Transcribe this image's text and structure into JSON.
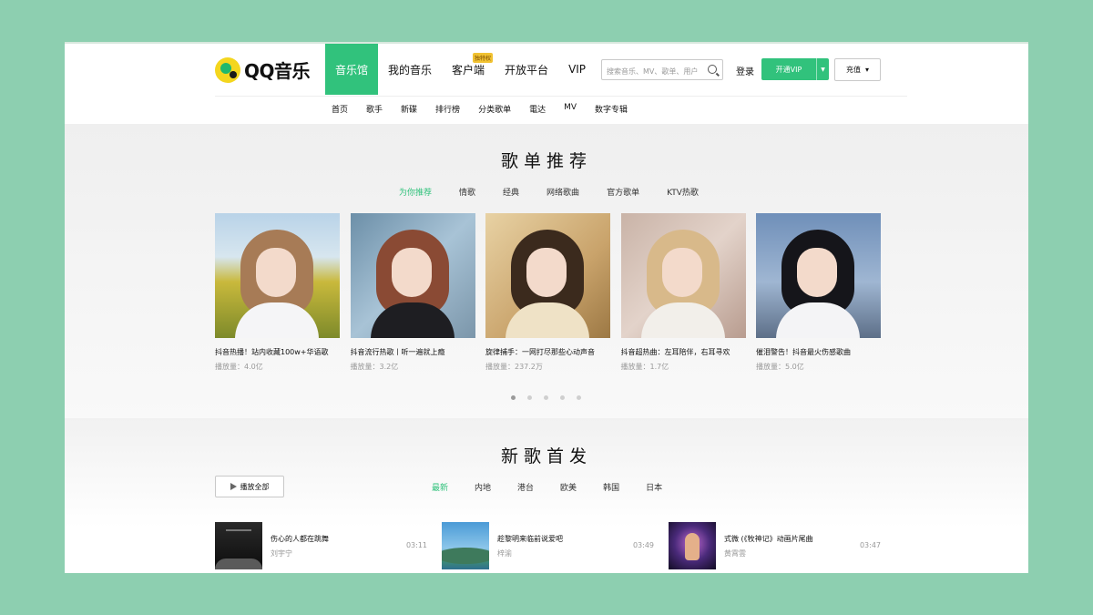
{
  "header": {
    "logo_text": "QQ音乐",
    "nav": [
      {
        "label": "音乐馆",
        "active": true
      },
      {
        "label": "我的音乐",
        "active": false
      },
      {
        "label": "客户端",
        "active": false,
        "badge": "独特权"
      },
      {
        "label": "开放平台",
        "active": false
      },
      {
        "label": "VIP",
        "active": false
      }
    ],
    "search_placeholder": "搜索音乐、MV、歌单、用户",
    "login_label": "登录",
    "vip_button_label": "开通VIP",
    "recharge_label": "充值",
    "subnav": [
      "首页",
      "歌手",
      "新碟",
      "排行榜",
      "分类歌单",
      "電达",
      "MV",
      "数字专辑"
    ]
  },
  "playlists_section": {
    "title": "歌单推荐",
    "tabs": [
      "为你推荐",
      "情歌",
      "经典",
      "网络歌曲",
      "官方歌单",
      "KTV热歌"
    ],
    "active_tab": 0,
    "cards": [
      {
        "title": "抖音热播！站内收藏100w+华语歌",
        "plays": "播放量：4.0亿"
      },
      {
        "title": "抖音流行热歌丨听一遍就上瘾",
        "plays": "播放量：3.2亿"
      },
      {
        "title": "旋律捕手：一网打尽那些心动声音",
        "plays": "播放量：237.2万"
      },
      {
        "title": "抖音超热曲：左耳陪伴，右耳寻欢",
        "plays": "播放量：1.7亿"
      },
      {
        "title": "催泪警告！抖音最火伤感歌曲",
        "plays": "播放量：5.0亿"
      }
    ],
    "dots_count": 5,
    "active_dot": 0
  },
  "new_songs_section": {
    "title": "新歌首发",
    "play_all_label": "播放全部",
    "tabs": [
      "最新",
      "内地",
      "港台",
      "欧美",
      "韩国",
      "日本"
    ],
    "active_tab": 0,
    "songs": [
      {
        "name": "伤心的人都在跳舞",
        "artist": "刘宇宁",
        "duration": "03:11"
      },
      {
        "name": "趁黎明来临前说爱吧",
        "artist": "梓渝",
        "duration": "03:49"
      },
      {
        "name": "式微 (《牧神记》动画片尾曲",
        "artist": "黄霄雲",
        "duration": "03:47"
      }
    ]
  },
  "colors": {
    "accent": "#31c27c",
    "background": "#8dcfb0",
    "logo_yellow": "#f4d61e"
  }
}
